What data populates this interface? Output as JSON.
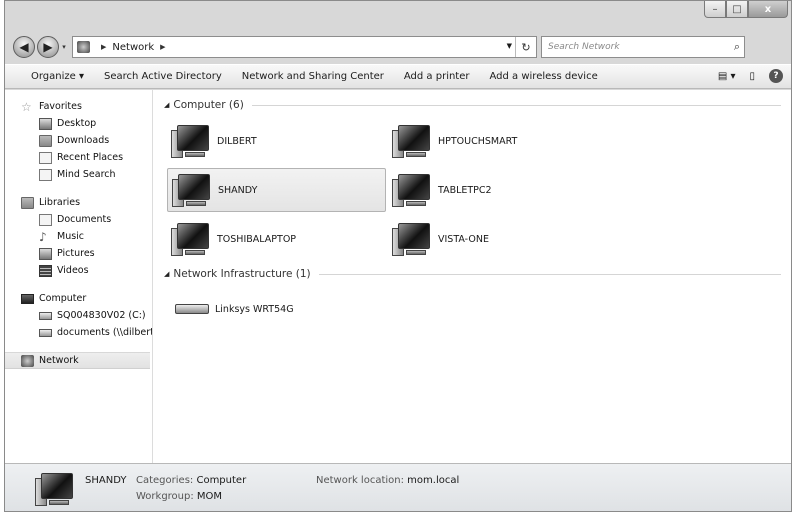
{
  "window": {
    "controls": {
      "minimize": "–",
      "maximize": "□",
      "close": "x"
    }
  },
  "address": {
    "back": "◀",
    "forward": "▶",
    "history": "▾",
    "crumbs": [
      "Network"
    ],
    "refresh": "↻",
    "search_placeholder": "Search Network"
  },
  "toolbar": {
    "items": [
      "Organize ▾",
      "Search Active Directory",
      "Network and Sharing Center",
      "Add a printer",
      "Add a wireless device"
    ],
    "view": "▤ ▾",
    "pane": "▯",
    "help": "?"
  },
  "nav": {
    "favorites": {
      "label": "Favorites",
      "items": [
        "Desktop",
        "Downloads",
        "Recent Places",
        "Mind Search"
      ]
    },
    "libraries": {
      "label": "Libraries",
      "items": [
        "Documents",
        "Music",
        "Pictures",
        "Videos"
      ]
    },
    "computer": {
      "label": "Computer",
      "items": [
        "SQ004830V02 (C:)",
        "documents (\\\\dilbert"
      ]
    },
    "network": {
      "label": "Network"
    }
  },
  "groups": {
    "computer": {
      "label": "Computer (6)",
      "items": [
        "DILBERT",
        "HPTOUCHSMART",
        "SHANDY",
        "TABLETPC2",
        "TOSHIBALAPTOP",
        "VISTA-ONE"
      ]
    },
    "infrastructure": {
      "label": "Network Infrastructure (1)",
      "items": [
        "Linksys WRT54G"
      ]
    }
  },
  "details": {
    "name": "SHANDY",
    "categories_label": "Categories:",
    "categories_value": "Computer",
    "workgroup_label": "Workgroup:",
    "workgroup_value": "MOM",
    "location_label": "Network location:",
    "location_value": "mom.local"
  }
}
